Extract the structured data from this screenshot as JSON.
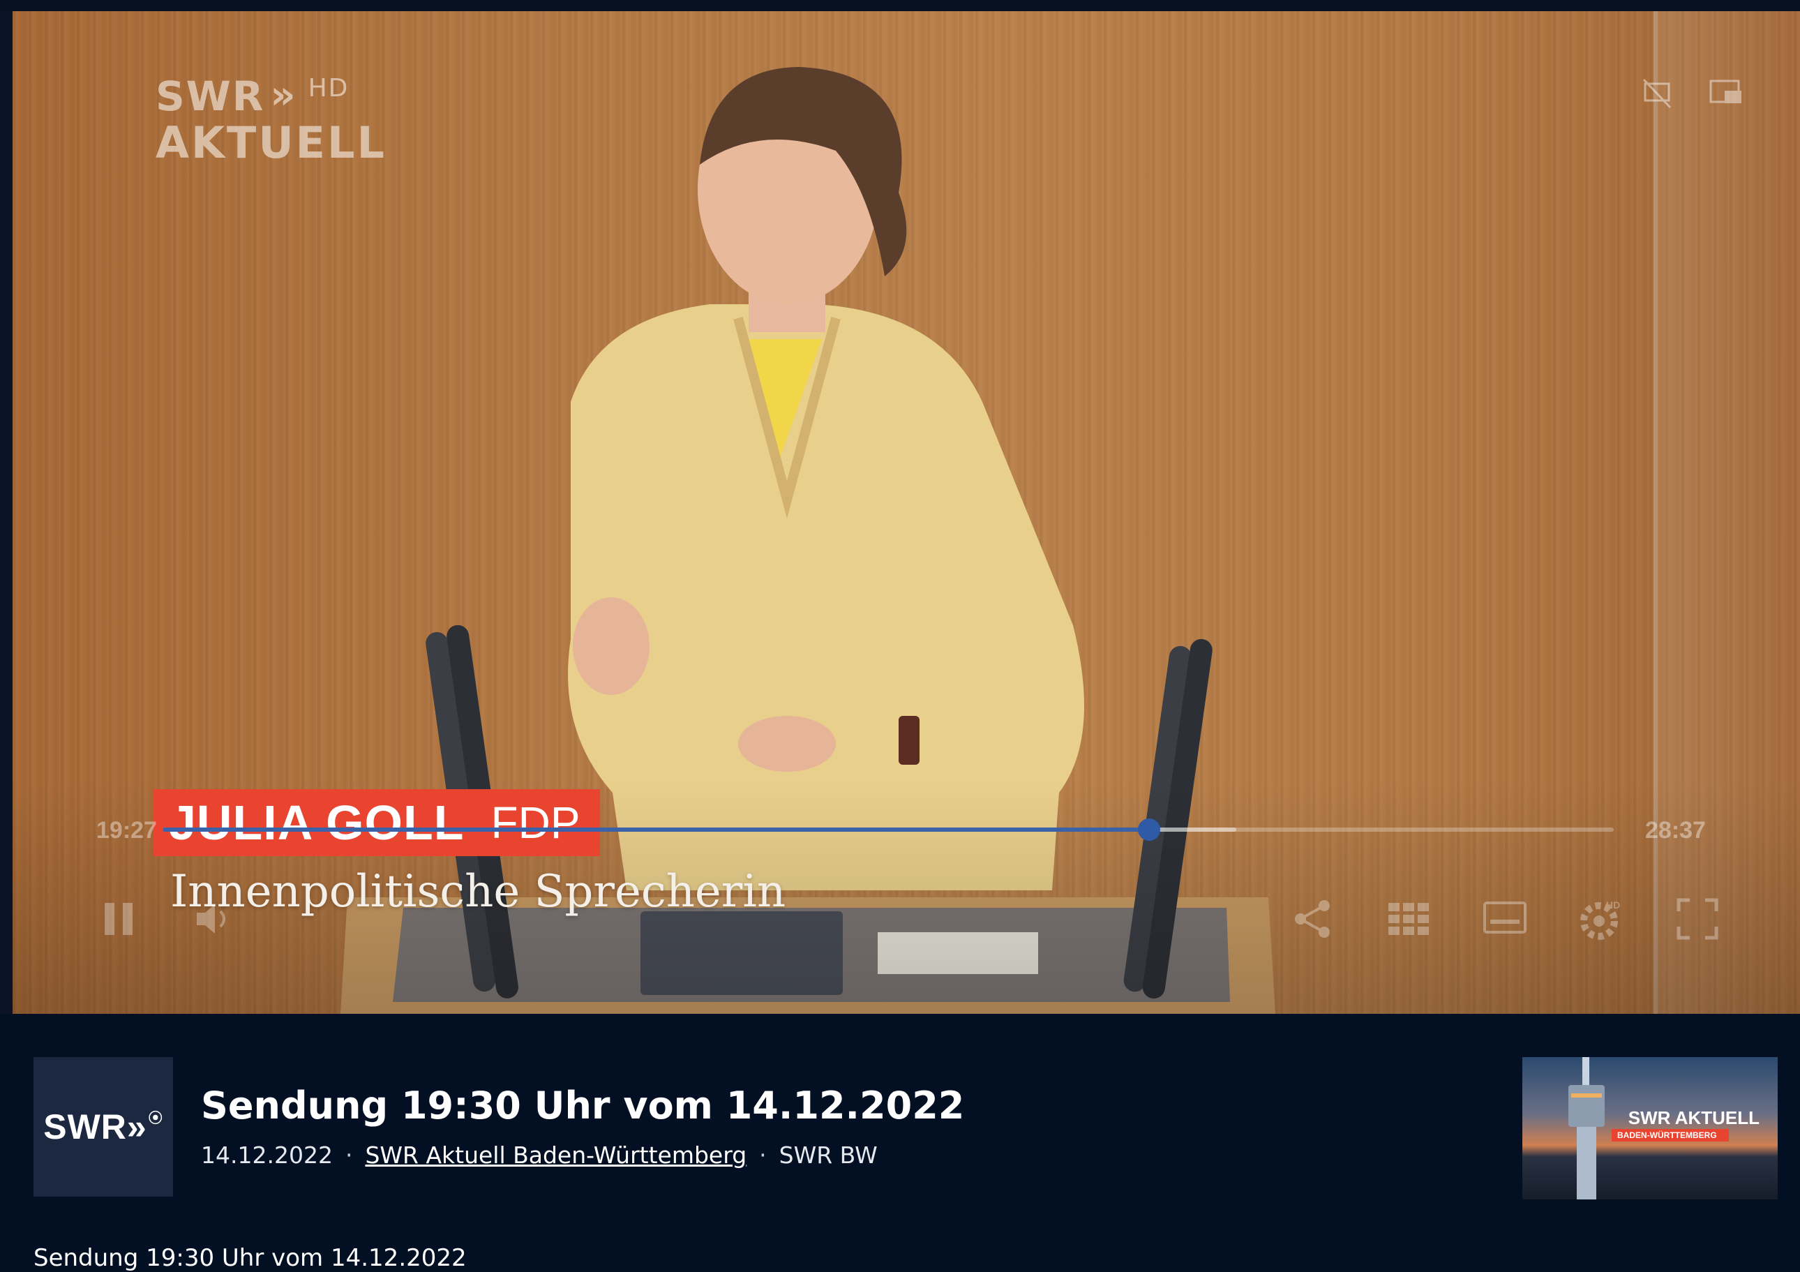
{
  "player": {
    "channel_overlay": {
      "line1": "SWR",
      "hd": "HD",
      "line2": "AKTUELL"
    },
    "lower_third": {
      "name": "JULIA GOLL",
      "party": "FDP",
      "role": "Innenpolitische Sprecherin"
    },
    "time_current": "19:27",
    "time_duration": "28:37",
    "progress_fraction": 0.68,
    "buffered_fraction": 0.74,
    "accent_color": "#3a62a8",
    "top_icons": [
      "captions-off-icon",
      "picture-in-picture-icon"
    ],
    "controls_left": [
      "pause-icon",
      "volume-icon"
    ],
    "controls_right": [
      "share-icon",
      "grid-icon",
      "subtitles-icon",
      "settings-hd-icon",
      "fullscreen-icon"
    ],
    "settings_badge": "HD"
  },
  "info": {
    "channel_logo": "SWR",
    "title": "Sendung 19:30 Uhr vom 14.12.2022",
    "date": "14.12.2022",
    "separator": "·",
    "show_link": "SWR Aktuell Baden-Württemberg",
    "broadcaster": "SWR BW",
    "thumbnail": {
      "line1": "SWR AKTUELL",
      "line2": "BADEN-WÜRTTEMBERG"
    }
  },
  "caption": "Sendung 19:30 Uhr vom 14.12.2022"
}
